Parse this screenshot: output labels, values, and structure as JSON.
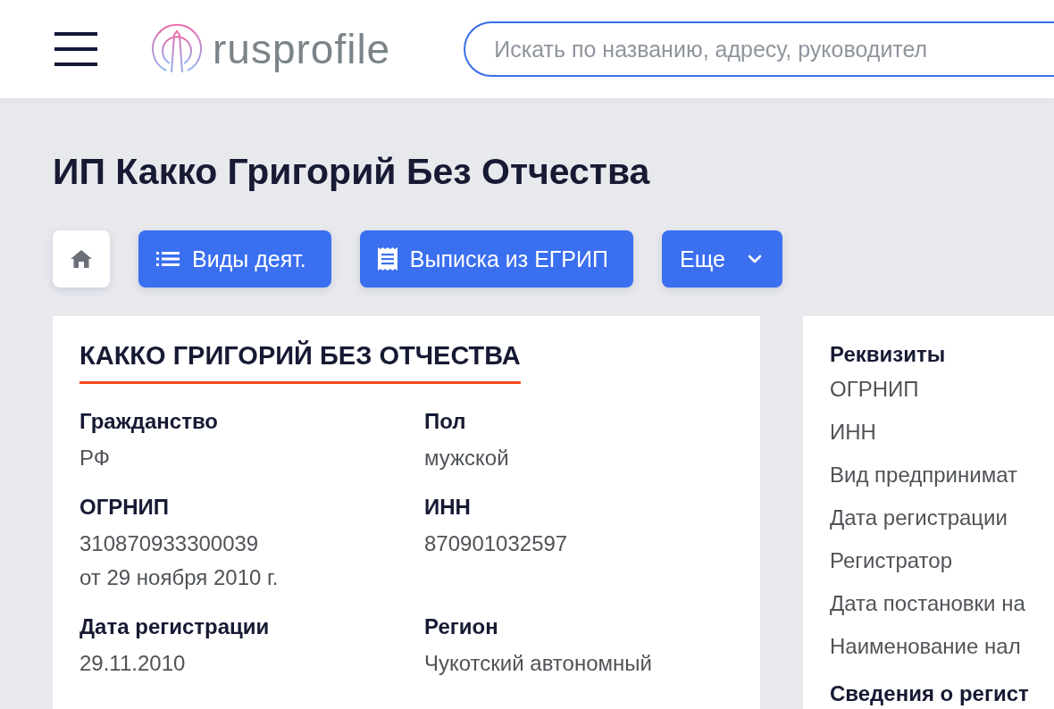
{
  "header": {
    "logo_text": "rusprofile",
    "search": {
      "placeholder": "Искать по названию, адресу, руководител"
    }
  },
  "title": "ИП Какко Григорий Без Отчества",
  "toolbar": [
    {
      "kind": "home"
    },
    {
      "kind": "list",
      "label": "Виды деят."
    },
    {
      "kind": "document",
      "label": "Выписка из ЕГРИП"
    },
    {
      "kind": "dropdown",
      "label": "Еще"
    }
  ],
  "main_card": {
    "heading": "КАККО ГРИГОРИЙ БЕЗ ОТЧЕСТВА",
    "fields": [
      {
        "label": "Гражданство",
        "values": [
          "РФ"
        ]
      },
      {
        "label": "Пол",
        "values": [
          "мужской"
        ]
      },
      {
        "label": "ОГРНИП",
        "values": [
          "310870933300039",
          "от 29 ноября 2010 г."
        ]
      },
      {
        "label": "ИНН",
        "values": [
          "870901032597"
        ]
      },
      {
        "label": "Дата регистрации",
        "values": [
          "29.11.2010"
        ]
      },
      {
        "label": "Регион",
        "values": [
          "Чукотский автономный"
        ]
      }
    ]
  },
  "side_card": {
    "heading": "Реквизиты",
    "items": [
      "ОГРНИП",
      "ИНН",
      "Вид предпринимат",
      "Дата регистрации",
      "Регистратор",
      "Дата постановки на",
      "Наименование нал"
    ],
    "next_heading": "Сведения о регист"
  }
}
